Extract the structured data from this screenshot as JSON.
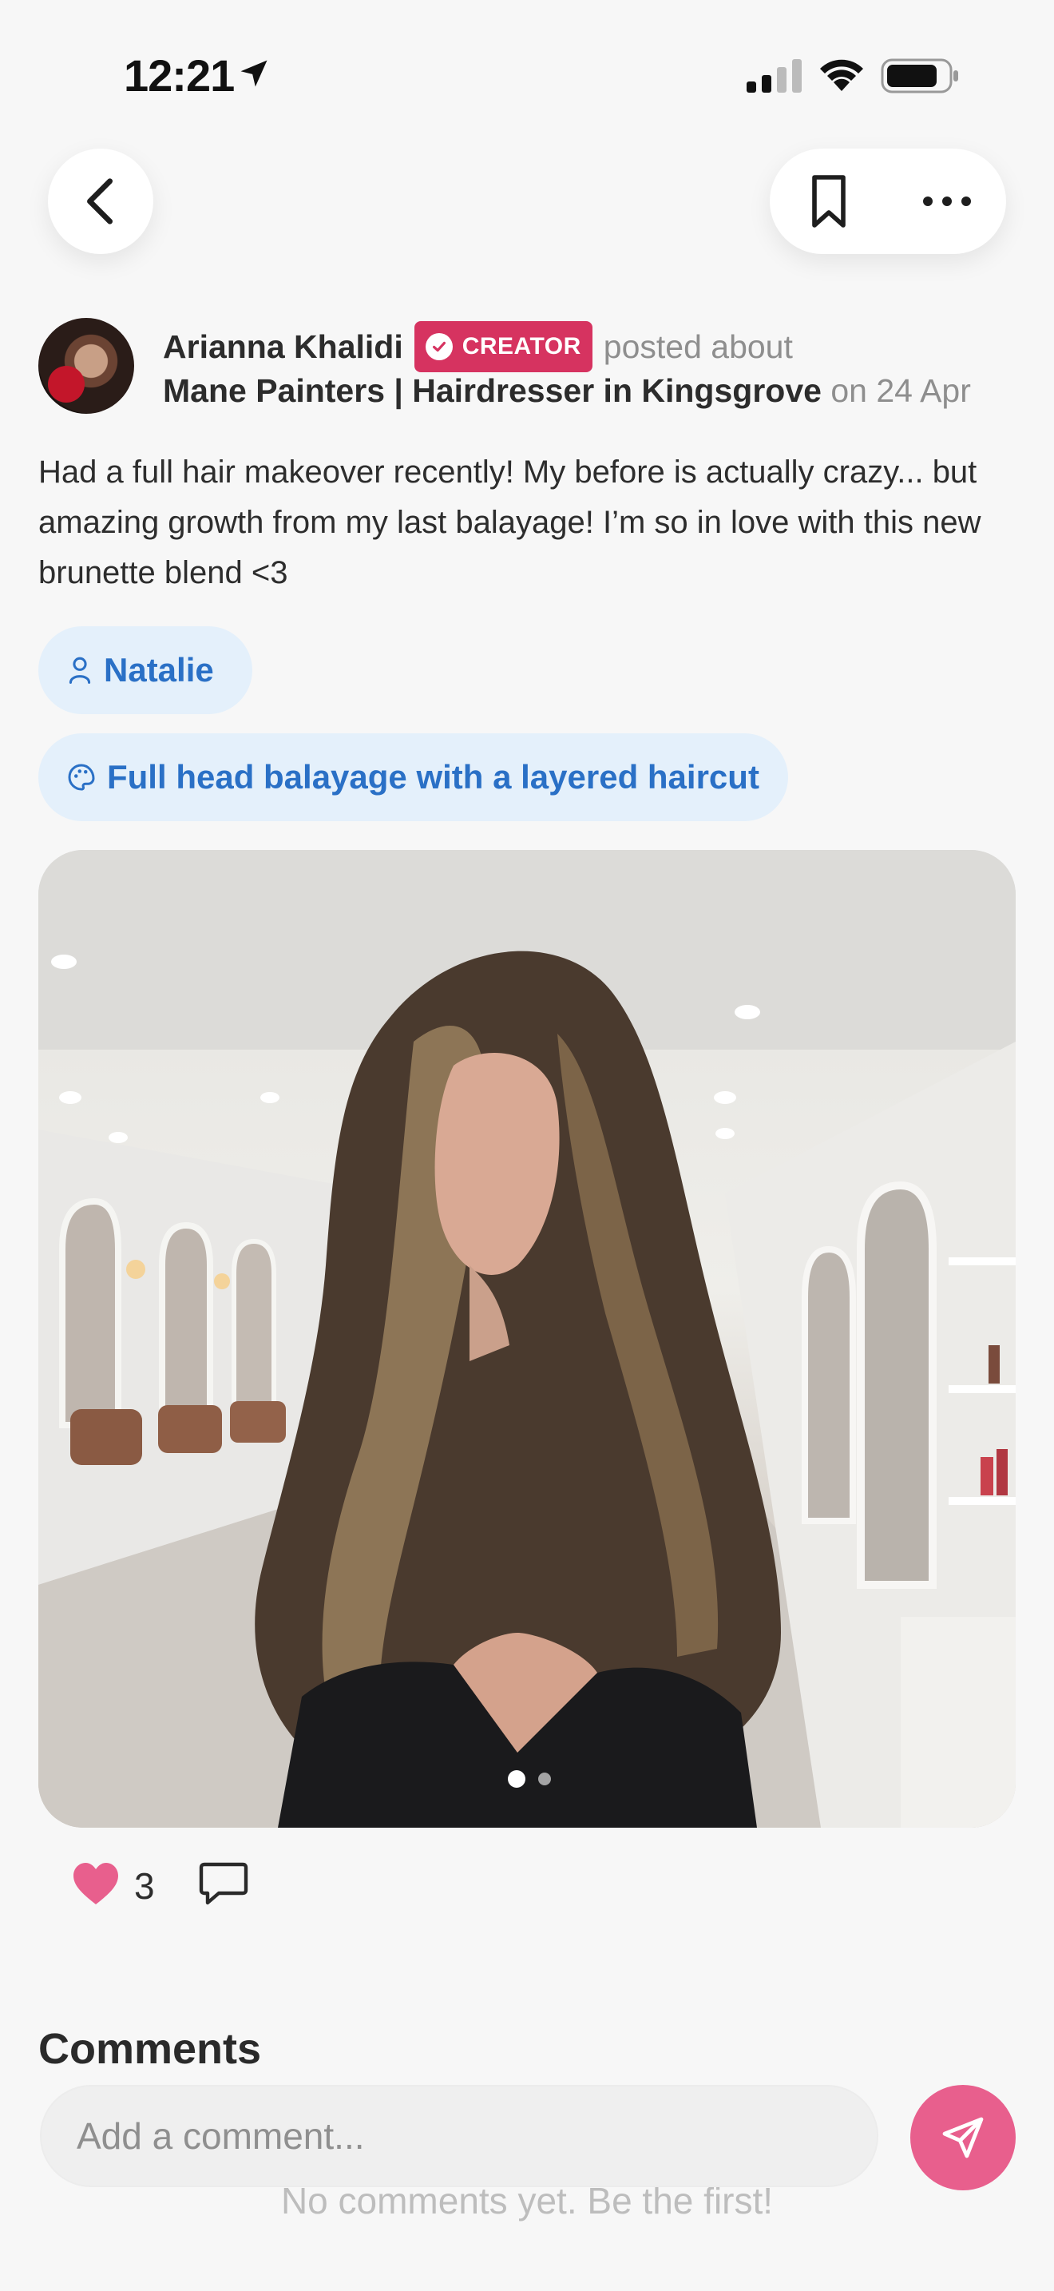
{
  "status_bar": {
    "time": "12:21"
  },
  "nav": {
    "back_icon": "chevron-left-icon",
    "bookmark_icon": "bookmark-icon",
    "more_icon": "more-icon"
  },
  "post": {
    "author": "Arianna Khalidi",
    "badge": "CREATOR",
    "posted_about": "posted about",
    "business": "Mane Painters | Hairdresser in Kingsgrove",
    "date": "on 24 Apr",
    "text": "Had a full hair makeover recently! My before is actually crazy... but amazing growth from my last balayage! I’m so in love with this new brunette blend <3",
    "tags": [
      {
        "icon": "person-icon",
        "label": "Natalie"
      },
      {
        "icon": "palette-icon",
        "label": "Full head balayage with a layered haircut"
      }
    ],
    "carousel": {
      "total": 2,
      "current": 1
    },
    "likes": "3",
    "liked": true
  },
  "comments": {
    "title": "Comments",
    "empty_text": "No comments yet. Be the first!",
    "placeholder": "Add a comment..."
  },
  "colors": {
    "accent": "#d63360",
    "send": "#e85f8d",
    "tag_bg": "#e4f0fb",
    "tag_text": "#2a70c6",
    "heart": "#e85f8d"
  }
}
